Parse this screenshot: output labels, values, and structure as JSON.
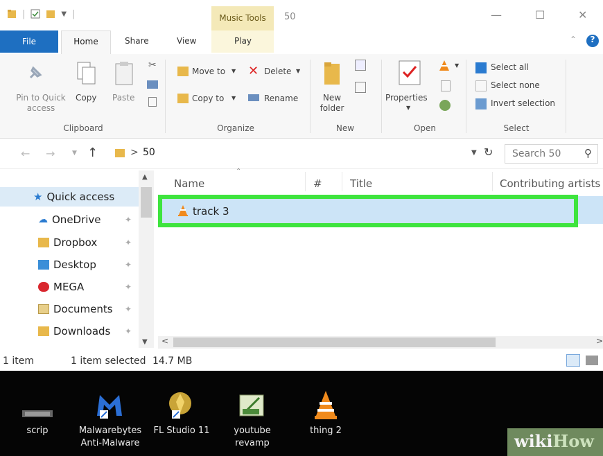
{
  "window": {
    "title": "50",
    "context_tab": "Music Tools",
    "controls": {
      "minimize": "—",
      "maximize": "☐",
      "close": "✕"
    }
  },
  "ribbon_tabs": {
    "file": "File",
    "home": "Home",
    "share": "Share",
    "view": "View",
    "play": "Play"
  },
  "ribbon": {
    "clipboard": {
      "pin": "Pin to Quick",
      "pin2": "access",
      "copy": "Copy",
      "paste": "Paste",
      "label": "Clipboard"
    },
    "organize": {
      "move_to": "Move to",
      "delete": "Delete",
      "copy_to": "Copy to",
      "rename": "Rename",
      "label": "Organize"
    },
    "new": {
      "new_folder": "New",
      "new_folder2": "folder",
      "label": "New"
    },
    "open": {
      "properties": "Properties",
      "label": "Open"
    },
    "select": {
      "select_all": "Select all",
      "select_none": "Select none",
      "invert": "Invert selection",
      "label": "Select"
    }
  },
  "address": {
    "path_sep": ">",
    "folder": "50",
    "search_placeholder": "Search 50"
  },
  "nav": {
    "items": [
      {
        "label": "Quick access"
      },
      {
        "label": "OneDrive"
      },
      {
        "label": "Dropbox"
      },
      {
        "label": "Desktop"
      },
      {
        "label": "MEGA"
      },
      {
        "label": "Documents"
      },
      {
        "label": "Downloads"
      }
    ]
  },
  "columns": {
    "name": "Name",
    "number": "#",
    "title": "Title",
    "artists": "Contributing artists"
  },
  "files": [
    {
      "name": "track 3",
      "icon": "vlc-cone-icon",
      "selected": true
    }
  ],
  "status": {
    "count": "1 item",
    "selected": "1 item selected",
    "size": "14.7 MB"
  },
  "desktop": {
    "icons": [
      {
        "label": "scrip",
        "label2": ""
      },
      {
        "label": "Malwarebytes",
        "label2": "Anti-Malware"
      },
      {
        "label": "FL Studio 11",
        "label2": ""
      },
      {
        "label": "youtube",
        "label2": "revamp"
      },
      {
        "label": "thing 2",
        "label2": ""
      }
    ],
    "watermark_a": "wiki",
    "watermark_b": "How"
  },
  "colors": {
    "file_tab": "#1e6fc1",
    "highlight": "#3ee43e",
    "selection": "#cce4f7",
    "context_tab": "#f4e9b8"
  }
}
